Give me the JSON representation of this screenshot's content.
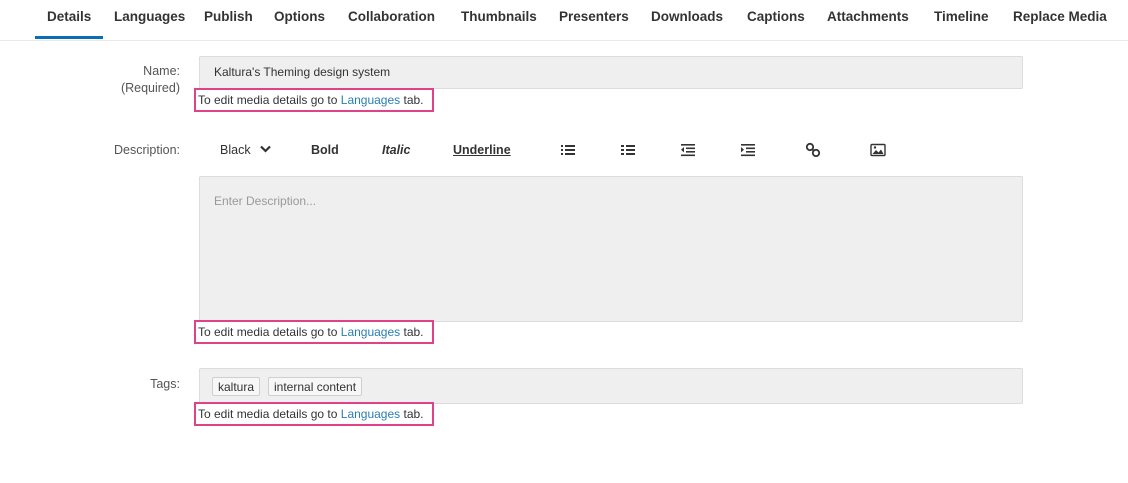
{
  "tabs": [
    {
      "label": "Details",
      "active": true
    },
    {
      "label": "Languages"
    },
    {
      "label": "Publish"
    },
    {
      "label": "Options"
    },
    {
      "label": "Collaboration"
    },
    {
      "label": "Thumbnails"
    },
    {
      "label": "Presenters"
    },
    {
      "label": "Downloads"
    },
    {
      "label": "Captions"
    },
    {
      "label": "Attachments"
    },
    {
      "label": "Timeline"
    },
    {
      "label": "Replace Media"
    }
  ],
  "name": {
    "label": "Name:",
    "required": "(Required)",
    "value": "Kaltura's Theming design system"
  },
  "description": {
    "label": "Description:",
    "placeholder": "Enter Description..."
  },
  "toolbar": {
    "color": "Black",
    "bold": "Bold",
    "italic": "Italic",
    "underline": "Underline",
    "icons": [
      "unordered-list-icon",
      "ordered-list-icon",
      "outdent-icon",
      "indent-icon",
      "link-icon",
      "image-icon"
    ]
  },
  "tags": {
    "label": "Tags:",
    "items": [
      "kaltura",
      "internal content"
    ]
  },
  "hint": {
    "prefix": "To edit media details go to ",
    "link": "Languages",
    "suffix": " tab."
  },
  "colors": {
    "accent": "#0a6fb0",
    "highlight_border": "#e0428a",
    "link": "#2a7eb3"
  }
}
